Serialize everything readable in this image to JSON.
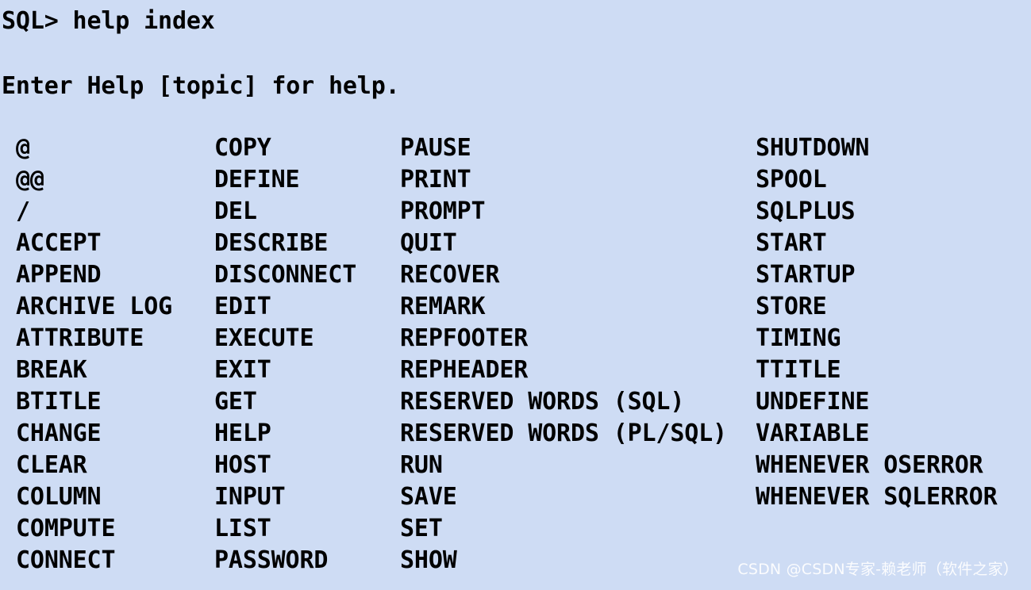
{
  "terminal": {
    "prompt_line": "SQL> help index",
    "help_hint": "Enter Help [topic] for help.",
    "columns": [
      {
        "items": [
          "@",
          "@@",
          "/",
          "ACCEPT",
          "APPEND",
          "ARCHIVE LOG",
          "ATTRIBUTE",
          "BREAK",
          "BTITLE",
          "CHANGE",
          "CLEAR",
          "COLUMN",
          "COMPUTE",
          "CONNECT"
        ]
      },
      {
        "items": [
          "COPY",
          "DEFINE",
          "DEL",
          "DESCRIBE",
          "DISCONNECT",
          "EDIT",
          "EXECUTE",
          "EXIT",
          "GET",
          "HELP",
          "HOST",
          "INPUT",
          "LIST",
          "PASSWORD"
        ]
      },
      {
        "items": [
          "PAUSE",
          "PRINT",
          "PROMPT",
          "QUIT",
          "RECOVER",
          "REMARK",
          "REPFOOTER",
          "REPHEADER",
          "RESERVED WORDS (SQL)",
          "RESERVED WORDS (PL/SQL)",
          "RUN",
          "SAVE",
          "SET",
          "SHOW"
        ]
      },
      {
        "items": [
          "SHUTDOWN",
          "SPOOL",
          "SQLPLUS",
          "START",
          "STARTUP",
          "STORE",
          "TIMING",
          "TTITLE",
          "UNDEFINE",
          "VARIABLE",
          "WHENEVER OSERROR",
          "WHENEVER SQLERROR"
        ]
      }
    ]
  },
  "watermark": {
    "text": "CSDN @CSDN专家-赖老师（软件之家）"
  },
  "colors": {
    "background": "#cedcf4",
    "text": "#000000",
    "watermark": "#ffffff"
  }
}
